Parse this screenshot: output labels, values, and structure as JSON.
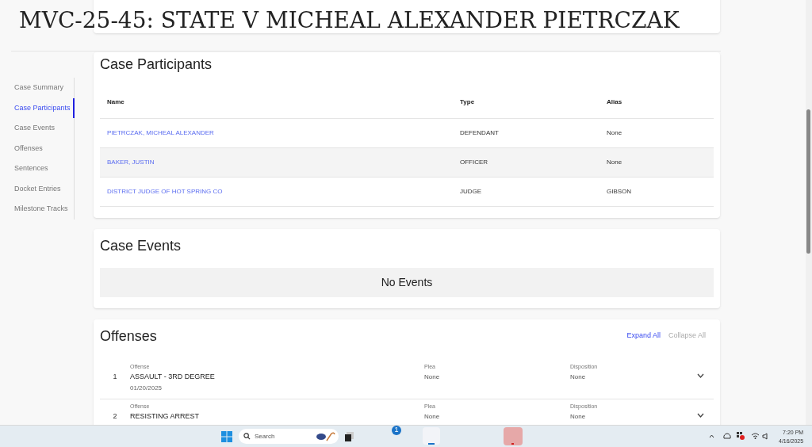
{
  "header": {
    "title": "MVC-25-45: STATE V MICHEAL ALEXANDER PIETRCZAK"
  },
  "sidebar": {
    "items": [
      {
        "label": "Case Summary",
        "selected": false
      },
      {
        "label": "Case Participants",
        "selected": true
      },
      {
        "label": "Case Events",
        "selected": false
      },
      {
        "label": "Offenses",
        "selected": false
      },
      {
        "label": "Sentences",
        "selected": false
      },
      {
        "label": "Docket Entries",
        "selected": false
      },
      {
        "label": "Milestone Tracks",
        "selected": false
      }
    ]
  },
  "participants": {
    "title": "Case Participants",
    "columns": [
      "Name",
      "Type",
      "Alias"
    ],
    "rows": [
      {
        "name": "PIETRCZAK, MICHEAL ALEXANDER",
        "type": "DEFENDANT",
        "alias": "None"
      },
      {
        "name": "BAKER, JUSTIN",
        "type": "OFFICER",
        "alias": "None"
      },
      {
        "name": "DISTRICT JUDGE OF HOT SPRING CO",
        "type": "JUDGE",
        "alias": "GIBSON"
      }
    ]
  },
  "events": {
    "title": "Case Events",
    "empty_text": "No Events"
  },
  "offenses": {
    "title": "Offenses",
    "expand_all": "Expand All",
    "collapse_all": "Collapse All",
    "rows": [
      {
        "number": "1",
        "offense_label": "Offense",
        "offense": "ASSAULT - 3RD DEGREE",
        "date": "01/20/2025",
        "plea_label": "Plea",
        "plea": "None",
        "disposition_label": "Disposition",
        "disposition": "None"
      },
      {
        "number": "2",
        "offense_label": "Offense",
        "offense": "RESISTING ARREST",
        "plea_label": "Plea",
        "plea": "None",
        "disposition_label": "Disposition",
        "disposition": "None"
      }
    ]
  },
  "taskbar": {
    "search_placeholder": "Search",
    "badge": "1",
    "time": "7:20 PM",
    "date": "4/16/2025"
  }
}
